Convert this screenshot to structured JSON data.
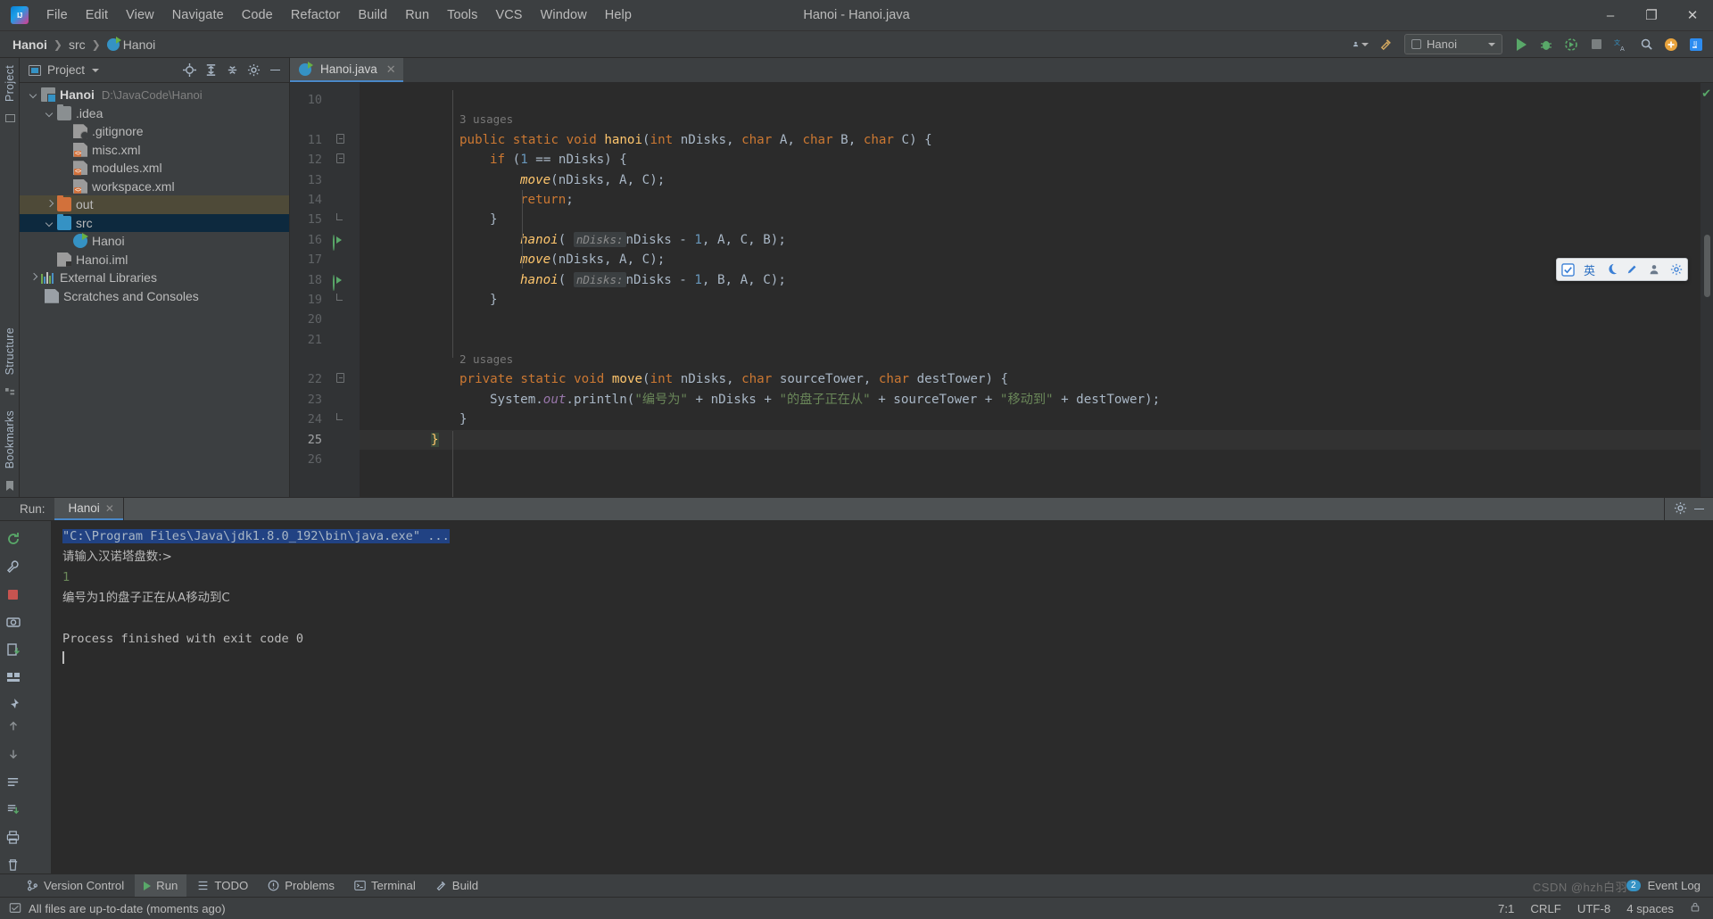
{
  "window": {
    "title": "Hanoi - Hanoi.java",
    "logo_icon": "intellij-idea-logo",
    "minimize": "–",
    "maximize": "❐",
    "close": "✕"
  },
  "menu": {
    "items": [
      {
        "label": "File"
      },
      {
        "label": "Edit"
      },
      {
        "label": "View"
      },
      {
        "label": "Navigate"
      },
      {
        "label": "Code"
      },
      {
        "label": "Refactor"
      },
      {
        "label": "Build"
      },
      {
        "label": "Run"
      },
      {
        "label": "Tools"
      },
      {
        "label": "VCS"
      },
      {
        "label": "Window"
      },
      {
        "label": "Help"
      }
    ]
  },
  "navbar": {
    "crumbs": [
      {
        "label": "Hanoi",
        "icon": "none"
      },
      {
        "label": "src",
        "icon": "none"
      },
      {
        "label": "Hanoi",
        "icon": "java-class-icon"
      }
    ],
    "separator": "❯",
    "run_config": "Hanoi",
    "icons": {
      "user": "user-account-icon",
      "updates": "hammer-build-icon",
      "run": "run-icon",
      "debug": "debug-icon",
      "coverage": "run-with-coverage-icon",
      "stop": "stop-icon",
      "translate": "translate-icon",
      "search": "search-everywhere-icon",
      "plus": "add-icon",
      "ide": "ide-icon"
    }
  },
  "left_strip": {
    "project_tab": "Project",
    "structure_tab": "Structure",
    "bookmarks_tab": "Bookmarks"
  },
  "project_panel": {
    "title": "Project",
    "dropdown_icon": "chevron-down-icon",
    "toolbar_icons": [
      "locate-target-icon",
      "expand-all-icon",
      "collapse-all-icon",
      "settings-gear-icon",
      "hide-panel-icon"
    ],
    "tree": [
      {
        "label": "Hanoi",
        "path": "D:\\JavaCode\\Hanoi",
        "icon": "module-icon",
        "indent": 0,
        "arrow": "down",
        "bold": true,
        "state": "normal"
      },
      {
        "label": ".idea",
        "path": "",
        "icon": "folder-icon",
        "indent": 1,
        "arrow": "down",
        "bold": false,
        "state": "normal"
      },
      {
        "label": ".gitignore",
        "path": "",
        "icon": "gitignore-file-icon",
        "indent": 2,
        "arrow": "none",
        "bold": false,
        "state": "normal"
      },
      {
        "label": "misc.xml",
        "path": "",
        "icon": "xml-file-icon",
        "indent": 2,
        "arrow": "none",
        "bold": false,
        "state": "normal"
      },
      {
        "label": "modules.xml",
        "path": "",
        "icon": "xml-file-icon",
        "indent": 2,
        "arrow": "none",
        "bold": false,
        "state": "normal"
      },
      {
        "label": "workspace.xml",
        "path": "",
        "icon": "xml-file-icon",
        "indent": 2,
        "arrow": "none",
        "bold": false,
        "state": "normal"
      },
      {
        "label": "out",
        "path": "",
        "icon": "folder-orange-icon",
        "indent": 1,
        "arrow": "right",
        "bold": false,
        "state": "highlight"
      },
      {
        "label": "src",
        "path": "",
        "icon": "folder-blue-icon",
        "indent": 1,
        "arrow": "down",
        "bold": false,
        "state": "selected"
      },
      {
        "label": "Hanoi",
        "path": "",
        "icon": "java-class-icon",
        "indent": 2,
        "arrow": "none",
        "bold": false,
        "state": "normal"
      },
      {
        "label": "Hanoi.iml",
        "path": "",
        "icon": "iml-file-icon",
        "indent": 1,
        "arrow": "none",
        "bold": false,
        "state": "normal"
      },
      {
        "label": "External Libraries",
        "path": "",
        "icon": "libraries-icon",
        "indent": 0,
        "arrow": "right",
        "bold": false,
        "state": "normal"
      },
      {
        "label": "Scratches and Consoles",
        "path": "",
        "icon": "scratches-icon",
        "indent": 0,
        "arrow": "none",
        "bold": false,
        "state": "normal"
      }
    ]
  },
  "editor": {
    "tab": {
      "label": "Hanoi.java",
      "icon": "java-class-icon",
      "close": "✕"
    },
    "first_line_number": 10,
    "current_line": 25,
    "caret_position": "7:1",
    "lines": [
      {
        "num": 10,
        "text": ""
      },
      {
        "num": null,
        "text": "3 usages",
        "kind": "usage",
        "indent": 2
      },
      {
        "num": 11,
        "text": "public static void hanoi(int nDisks, char A, char B, char C) {",
        "fold": "open",
        "gicon": ""
      },
      {
        "num": 12,
        "text": "if (1 == nDisks) {",
        "fold": "open"
      },
      {
        "num": 13,
        "text": "move(nDisks, A, C);"
      },
      {
        "num": 14,
        "text": "return;"
      },
      {
        "num": 15,
        "text": "}",
        "fold": "close"
      },
      {
        "num": 16,
        "text": "hanoi( nDisks: nDisks - 1, A, C, B);",
        "gicon": "recursive-call-icon"
      },
      {
        "num": 17,
        "text": "move(nDisks, A, C);"
      },
      {
        "num": 18,
        "text": "hanoi( nDisks: nDisks - 1, B, A, C);",
        "gicon": "recursive-call-icon"
      },
      {
        "num": 19,
        "text": "}",
        "fold": "close"
      },
      {
        "num": 20,
        "text": ""
      },
      {
        "num": 21,
        "text": ""
      },
      {
        "num": null,
        "text": "2 usages",
        "kind": "usage",
        "indent": 2
      },
      {
        "num": 22,
        "text": "private static void move(int nDisks, char sourceTower, char destTower) {",
        "fold": "open"
      },
      {
        "num": 23,
        "text": "System.out.println(\"编号为\" + nDisks + \"的盘子正在从\" + sourceTower + \"移动到\" + destTower);"
      },
      {
        "num": 24,
        "text": "}",
        "fold": "close"
      },
      {
        "num": 25,
        "text": "}",
        "current": true
      },
      {
        "num": 26,
        "text": ""
      }
    ],
    "parameter_hint": "nDisks:",
    "usages_hanoi": "3 usages",
    "usages_move": "2 usages",
    "inspection_status": "✔"
  },
  "ime_bar": {
    "icons": [
      "ime-checkbox-icon",
      "chinese-english-icon",
      "moon-icon",
      "pen-icon",
      "user-icon",
      "settings-gear-icon"
    ],
    "lang_label": "英"
  },
  "run_panel": {
    "label": "Run:",
    "tab": {
      "label": "Hanoi",
      "icon": "run-config-icon",
      "close": "✕"
    },
    "toolbar_icons": [
      "rerun-icon",
      "up-arrow-icon",
      "wrench-icon",
      "down-arrow-icon",
      "stop-icon",
      "layout-icon",
      "camera-icon",
      "scroll-to-end-icon",
      "export-icon",
      "print-icon",
      "grid-icon",
      "trash-icon"
    ],
    "settings_icon": "settings-gear-icon",
    "minimize_icon": "minimize-icon",
    "console_lines": [
      {
        "text": "\"C:\\Program Files\\Java\\jdk1.8.0_192\\bin\\java.exe\" ...",
        "style": "selected"
      },
      {
        "text": "请输入汉诺塔盘数:>",
        "style": "cn"
      },
      {
        "text": "1",
        "style": "green"
      },
      {
        "text": "编号为1的盘子正在从A移动到C",
        "style": "cn"
      },
      {
        "text": "",
        "style": "plain"
      },
      {
        "text": "Process finished with exit code 0",
        "style": "plain"
      },
      {
        "text": "",
        "style": "caret"
      }
    ]
  },
  "bottom_bar": {
    "items": [
      {
        "label": "Version Control",
        "icon": "version-control-icon",
        "active": false
      },
      {
        "label": "Run",
        "icon": "run-icon",
        "active": true
      },
      {
        "label": "TODO",
        "icon": "todo-icon",
        "active": false
      },
      {
        "label": "Problems",
        "icon": "problems-icon",
        "active": false
      },
      {
        "label": "Terminal",
        "icon": "terminal-icon",
        "active": false
      },
      {
        "label": "Build",
        "icon": "build-hammer-icon",
        "active": false
      }
    ],
    "event_log": {
      "label": "Event Log",
      "count": "2"
    }
  },
  "status_bar": {
    "message": "All files are up-to-date (moments ago)",
    "message_icon": "sync-ok-icon",
    "caret": "7:1",
    "line_separator": "CRLF",
    "encoding": "UTF-8",
    "indent": "4 spaces",
    "lock_icon": "lock-icon"
  },
  "watermark": "CSDN @hzh白羽"
}
